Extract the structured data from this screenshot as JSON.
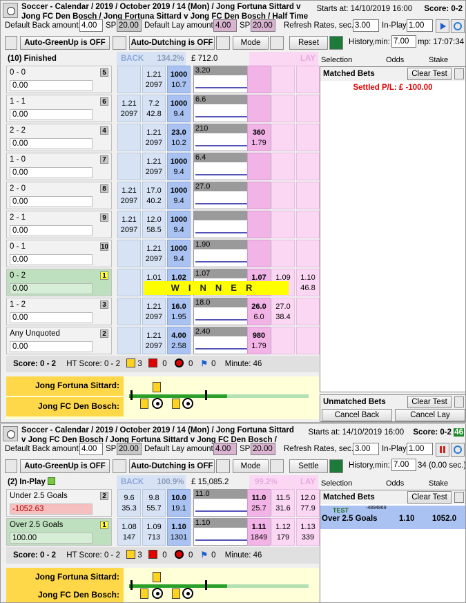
{
  "top": {
    "title_line1": "Soccer - Calendar / 2019 / October 2019 / 14 (Mon) / Jong Fortuna Sittard v",
    "title_line2": "Jong FC Den Bosch / Jong Fortuna Sittard v Jong FC Den Bosch / Half Time",
    "starts_label": "Starts at: 14/10/2019 16:00",
    "score_label": "Score: 0-2",
    "default_back_label": "Default Back amount:",
    "default_back_value": "4.00",
    "sp_label": "SP",
    "sp_back_value": "20.00",
    "default_lay_label": "Default Lay amount:",
    "default_lay_value": "4.00",
    "sp_lay_value": "20.00",
    "refresh_label": "Refresh Rates, sec.",
    "refresh_value": "3.00",
    "inplay_label": "In-Play",
    "inplay_value": "1.00",
    "greenup_label": "Auto-GreenUp is OFF",
    "dutching_label": "Auto-Dutching is OFF",
    "mode_label": "Mode",
    "reset_label": "Reset",
    "history_label": "History,min:",
    "history_value": "7.00",
    "history_time": "mp: 17:07:34",
    "market_status": "(10) Finished",
    "back_label": "BACK",
    "back_pct": "134.2%",
    "matched_total": "£ 712.0",
    "lay_label": "LAY",
    "col_selection": "Selection",
    "col_odds": "Odds",
    "col_stake": "Stake",
    "matched_bets_label": "Matched Bets",
    "clear_test_label": "Clear Test",
    "settled_label": "Settled P/L: £ -100.00",
    "unmatched_bets_label": "Unmatched Bets",
    "clear_test2_label": "Clear Test",
    "cancel_back_label": "Cancel Back",
    "cancel_lay_label": "Cancel Lay",
    "winner_text": "WINNER",
    "rows": [
      {
        "name": "0 - 0",
        "idx": "5",
        "pl": "0.00",
        "b3": [
          "",
          ""
        ],
        "b2": [
          "1.21",
          "2097"
        ],
        "b1": [
          "1000",
          "10.7"
        ],
        "graph": "3.20",
        "l1": [
          "",
          ""
        ],
        "l2": [
          "",
          ""
        ],
        "l3": [
          "",
          ""
        ]
      },
      {
        "name": "1 - 1",
        "idx": "6",
        "pl": "0.00",
        "b3": [
          "1.21",
          "2097"
        ],
        "b2": [
          "7.2",
          "42.8"
        ],
        "b1": [
          "1000",
          "9.4"
        ],
        "graph": "6.6",
        "l1": [
          "",
          ""
        ],
        "l2": [
          "",
          ""
        ],
        "l3": [
          "",
          ""
        ]
      },
      {
        "name": "2 - 2",
        "idx": "4",
        "pl": "0.00",
        "b3": [
          "",
          ""
        ],
        "b2": [
          "1.21",
          "2097"
        ],
        "b1": [
          "23.0",
          "10.2"
        ],
        "graph": "210",
        "l1": [
          "360",
          "1.79"
        ],
        "l2": [
          "",
          ""
        ],
        "l3": [
          "",
          ""
        ]
      },
      {
        "name": "1 - 0",
        "idx": "7",
        "pl": "0.00",
        "b3": [
          "",
          ""
        ],
        "b2": [
          "1.21",
          "2097"
        ],
        "b1": [
          "1000",
          "9.4"
        ],
        "graph": "6.4",
        "l1": [
          "",
          ""
        ],
        "l2": [
          "",
          ""
        ],
        "l3": [
          "",
          ""
        ]
      },
      {
        "name": "2 - 0",
        "idx": "8",
        "pl": "0.00",
        "b3": [
          "1.21",
          "2097"
        ],
        "b2": [
          "17.0",
          "40.2"
        ],
        "b1": [
          "1000",
          "9.4"
        ],
        "graph": "27.0",
        "l1": [
          "",
          ""
        ],
        "l2": [
          "",
          ""
        ],
        "l3": [
          "",
          ""
        ]
      },
      {
        "name": "2 - 1",
        "idx": "9",
        "pl": "0.00",
        "b3": [
          "1.21",
          "2097"
        ],
        "b2": [
          "12.0",
          "58.5"
        ],
        "b1": [
          "1000",
          "9.4"
        ],
        "graph": "",
        "l1": [
          "",
          ""
        ],
        "l2": [
          "",
          ""
        ],
        "l3": [
          "",
          ""
        ]
      },
      {
        "name": "0 - 1",
        "idx": "10",
        "pl": "0.00",
        "b3": [
          "",
          ""
        ],
        "b2": [
          "1.21",
          "2097"
        ],
        "b1": [
          "1000",
          "9.4"
        ],
        "graph": "1.90",
        "l1": [
          "",
          ""
        ],
        "l2": [
          "",
          ""
        ],
        "l3": [
          "",
          ""
        ]
      },
      {
        "name": "0 - 2",
        "idx": "1",
        "pl": "0.00",
        "b3": [
          "",
          ""
        ],
        "b2": [
          "1.01",
          "1"
        ],
        "b1": [
          "1.02",
          "1"
        ],
        "graph": "1.07",
        "l1": [
          "1.07",
          ""
        ],
        "l2": [
          "1.09",
          "4"
        ],
        "l3": [
          "1.10",
          "46.8"
        ]
      },
      {
        "name": "1 - 2",
        "idx": "3",
        "pl": "0.00",
        "b3": [
          "",
          ""
        ],
        "b2": [
          "1.21",
          "2097"
        ],
        "b1": [
          "16.0",
          "1.95"
        ],
        "graph": "18.0",
        "l1": [
          "26.0",
          "6.0"
        ],
        "l2": [
          "27.0",
          "38.4"
        ],
        "l3": [
          "",
          ""
        ]
      },
      {
        "name": "Any Unquoted",
        "idx": "2",
        "pl": "0.00",
        "b3": [
          "",
          ""
        ],
        "b2": [
          "1.21",
          "2097"
        ],
        "b1": [
          "4.00",
          "2.58"
        ],
        "graph": "2.40",
        "l1": [
          "980",
          "1.79"
        ],
        "l2": [
          "",
          ""
        ],
        "l3": [
          "",
          ""
        ]
      }
    ],
    "footer": {
      "score": "Score: 0 - 2",
      "ht_score": "HT Score: 0 - 2",
      "yellow_count": "3",
      "red_count": "0",
      "penalty_count": "0",
      "corner_count": "0",
      "minute": "Minute: 46",
      "home_team": "Jong Fortuna Sittard:",
      "away_team": "Jong FC Den Bosch:"
    }
  },
  "bottom": {
    "title_line1": "Soccer - Calendar / 2019 / October 2019 / 14 (Mon) / Jong Fortuna Sittard",
    "title_line2": "v Jong FC Den Bosch / Jong Fortuna Sittard v Jong FC Den Bosch /",
    "starts_label": "Starts at: 14/10/2019 16:00",
    "score_label": "Score: 0-2",
    "minute_badge": "46",
    "default_back_label": "Default Back amount:",
    "default_back_value": "4.00",
    "sp_label": "SP",
    "sp_back_value": "20.00",
    "default_lay_label": "Default Lay amount:",
    "default_lay_value": "4.00",
    "sp_lay_value": "20.00",
    "refresh_label": "Refresh Rates, sec.",
    "refresh_value": "3.00",
    "inplay_label": "In-Play",
    "inplay_value": "1.00",
    "greenup_label": "Auto-GreenUp is OFF",
    "dutching_label": "Auto-Dutching is OFF",
    "mode_label": "Mode",
    "settle_label": "Settle",
    "history_label": "History,min:",
    "history_value": "7.00",
    "history_time": "34 (0.00 sec.)",
    "market_status": "(2) In-Play",
    "back_label": "BACK",
    "back_pct": "100.9%",
    "matched_total": "£ 15,085.2",
    "lay_pct": "99.2%",
    "lay_label": "LAY",
    "col_selection": "Selection",
    "col_odds": "Odds",
    "col_stake": "Stake",
    "matched_bets_label": "Matched Bets",
    "clear_test_label": "Clear Test",
    "bet_tag": "TEST",
    "bet_id": "-4894869",
    "bet_selection": "Over 2.5 Goals",
    "bet_odds": "1.10",
    "bet_stake": "1052.0",
    "rows": [
      {
        "name": "Under 2.5 Goals",
        "idx": "2",
        "pl": "-1052.63",
        "b3": [
          "9.6",
          "35.3"
        ],
        "b2": [
          "9.8",
          "55.7"
        ],
        "b1": [
          "10.0",
          "19.1"
        ],
        "graph": "11.0",
        "l1": [
          "11.0",
          "25.7"
        ],
        "l2": [
          "11.5",
          "31.6"
        ],
        "l3": [
          "12.0",
          "77.9"
        ]
      },
      {
        "name": "Over 2.5 Goals",
        "idx": "1",
        "pl": "100.00",
        "b3": [
          "1.08",
          "147"
        ],
        "b2": [
          "1.09",
          "713"
        ],
        "b1": [
          "1.10",
          "1301"
        ],
        "graph": "1.10",
        "l1": [
          "1.11",
          "1849"
        ],
        "l2": [
          "1.12",
          "179"
        ],
        "l3": [
          "1.13",
          "339"
        ]
      }
    ],
    "footer": {
      "score": "Score: 0 - 2",
      "ht_score": "HT Score: 0 - 2",
      "yellow_count": "3",
      "red_count": "0",
      "penalty_count": "0",
      "corner_count": "0",
      "minute": "Minute: 46",
      "home_team": "Jong Fortuna Sittard:",
      "away_team": "Jong FC Den Bosch:"
    }
  }
}
